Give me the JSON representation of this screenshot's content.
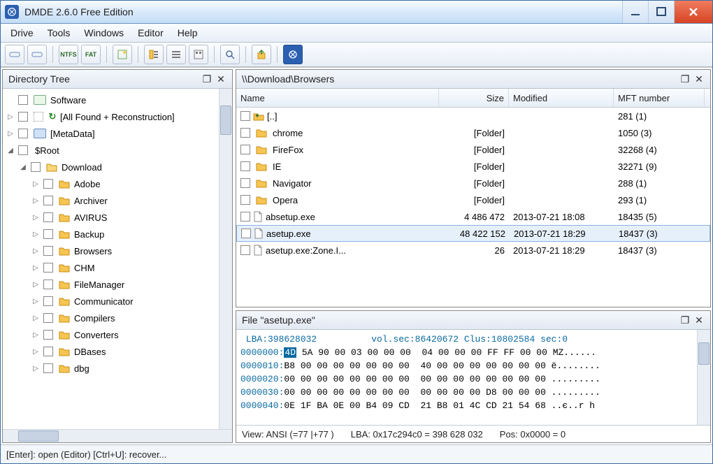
{
  "window": {
    "title": "DMDE 2.6.0 Free Edition"
  },
  "menu": {
    "drive": "Drive",
    "tools": "Tools",
    "windows": "Windows",
    "editor": "Editor",
    "help": "Help"
  },
  "toolbar_labels": {
    "ntfs": "NTFS",
    "fat": "FAT"
  },
  "tree": {
    "title": "Directory Tree",
    "root": "Software",
    "all_found": "[All Found + Reconstruction]",
    "metadata": "[MetaData]",
    "sroot": "$Root",
    "download": "Download",
    "children": [
      "Adobe",
      "Archiver",
      "AVIRUS",
      "Backup",
      "Browsers",
      "CHM",
      "FileManager",
      "Communicator",
      "Compilers",
      "Converters",
      "DBases",
      "dbg"
    ]
  },
  "list": {
    "path": "\\\\Download\\Browsers",
    "cols": {
      "name": "Name",
      "size": "Size",
      "modified": "Modified",
      "mft": "MFT number"
    },
    "rows": [
      {
        "kind": "up",
        "name": "[..]",
        "size": "",
        "modified": "",
        "mft": "281 (1)"
      },
      {
        "kind": "folder",
        "name": "chrome",
        "size": "[Folder]",
        "modified": "",
        "mft": "1050 (3)"
      },
      {
        "kind": "folder",
        "name": "FireFox",
        "size": "[Folder]",
        "modified": "",
        "mft": "32268 (4)"
      },
      {
        "kind": "folder",
        "name": "IE",
        "size": "[Folder]",
        "modified": "",
        "mft": "32271 (9)"
      },
      {
        "kind": "folder",
        "name": "Navigator",
        "size": "[Folder]",
        "modified": "",
        "mft": "288 (1)"
      },
      {
        "kind": "folder",
        "name": "Opera",
        "size": "[Folder]",
        "modified": "",
        "mft": "293 (1)"
      },
      {
        "kind": "file",
        "name": "absetup.exe",
        "size": "4 486 472",
        "modified": "2013-07-21 18:08",
        "mft": "18435 (5)"
      },
      {
        "kind": "file",
        "name": "asetup.exe",
        "size": "48 422 152",
        "modified": "2013-07-21 18:29",
        "mft": "18437 (3)",
        "selected": true
      },
      {
        "kind": "file",
        "name": "asetup.exe:Zone.I...",
        "size": "26",
        "modified": "2013-07-21 18:29",
        "mft": "18437 (3)"
      }
    ]
  },
  "hex": {
    "title": "File \"asetup.exe\"",
    "info": " LBA:398628032          vol.sec:86420672 Clus:10802584 sec:0",
    "lines": [
      {
        "addr": "0000000:",
        "sel": "4D",
        "rest": " 5A 90 00 03 00 00 00  04 00 00 00 FF FF 00 00 MZ......"
      },
      {
        "addr": "0000010:",
        "sel": "",
        "rest": "B8 00 00 00 00 00 00 00  40 00 00 00 00 00 00 00 ё........"
      },
      {
        "addr": "0000020:",
        "sel": "",
        "rest": "00 00 00 00 00 00 00 00  00 00 00 00 00 00 00 00 ........."
      },
      {
        "addr": "0000030:",
        "sel": "",
        "rest": "00 00 00 00 00 00 00 00  00 00 00 00 D8 00 00 00 ........."
      },
      {
        "addr": "0000040:",
        "sel": "",
        "rest": "0E 1F BA 0E 00 B4 09 CD  21 B8 01 4C CD 21 54 68 ..є..r h"
      }
    ],
    "status": {
      "view": "View: ANSI (=77 |+77 )",
      "lba": "LBA: 0x17c294c0 = 398 628 032",
      "pos": "Pos: 0x0000 = 0"
    }
  },
  "status": "[Enter]: open (Editor)  [Ctrl+U]: recover..."
}
